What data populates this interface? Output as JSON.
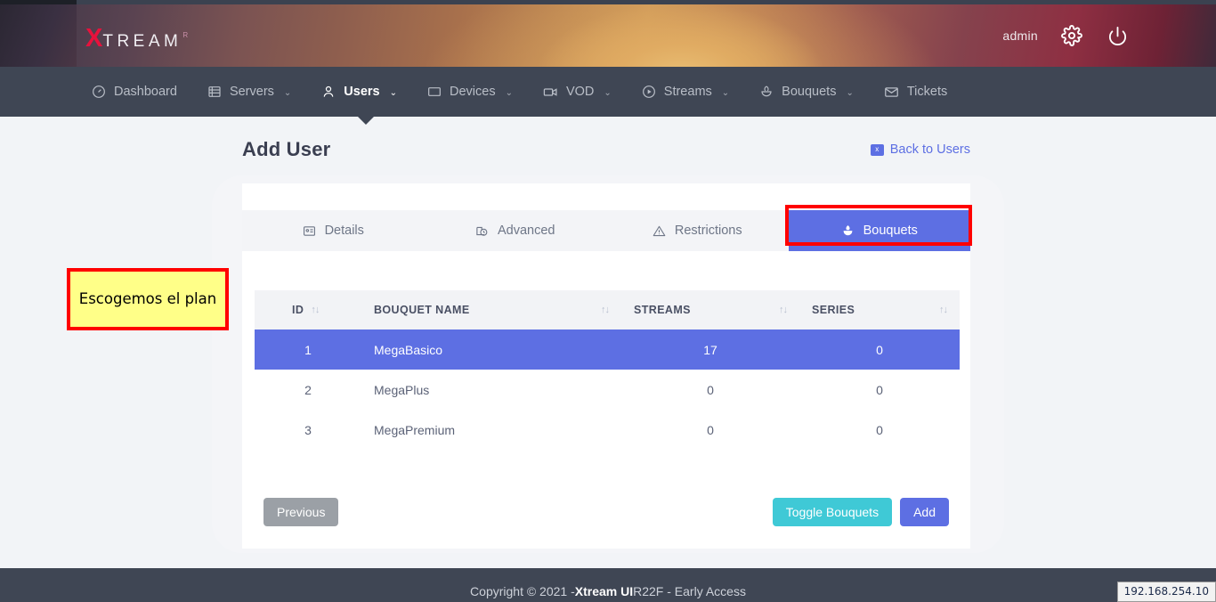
{
  "banner": {
    "logo_x": "X",
    "logo_rest": "TREAM",
    "logo_sup": "R",
    "admin_label": "admin",
    "gear_icon": "gear-icon",
    "power_icon": "power-icon"
  },
  "nav": {
    "items": [
      {
        "label": "Dashboard",
        "icon": "gauge-icon",
        "caret": "",
        "active": false
      },
      {
        "label": "Servers",
        "icon": "server-list-icon",
        "caret": "⌄",
        "active": false
      },
      {
        "label": "Users",
        "icon": "user-icon",
        "caret": "⌄",
        "active": true
      },
      {
        "label": "Devices",
        "icon": "device-icon",
        "caret": "⌄",
        "active": false
      },
      {
        "label": "VOD",
        "icon": "video-icon",
        "caret": "⌄",
        "active": false
      },
      {
        "label": "Streams",
        "icon": "play-circle-icon",
        "caret": "⌄",
        "active": false
      },
      {
        "label": "Bouquets",
        "icon": "bouquet-icon",
        "caret": "⌄",
        "active": false
      },
      {
        "label": "Tickets",
        "icon": "envelope-icon",
        "caret": "",
        "active": false
      }
    ]
  },
  "page": {
    "title": "Add User",
    "back_link": "Back to Users",
    "back_badge": "x"
  },
  "tabs": [
    {
      "label": "Details",
      "icon": "id-card-icon",
      "active": false
    },
    {
      "label": "Advanced",
      "icon": "clock-box-icon",
      "active": false
    },
    {
      "label": "Restrictions",
      "icon": "warning-triangle-icon",
      "active": false
    },
    {
      "label": "Bouquets",
      "icon": "bouquet-icon",
      "active": true
    }
  ],
  "table": {
    "columns": [
      {
        "label": "ID",
        "sort": "↑↓"
      },
      {
        "label": "BOUQUET NAME",
        "sort": "↑↓"
      },
      {
        "label": "STREAMS",
        "sort": "↑↓"
      },
      {
        "label": "SERIES",
        "sort": "↑↓"
      }
    ],
    "rows": [
      {
        "id": "1",
        "name": "MegaBasico",
        "streams": "17",
        "series": "0",
        "selected": true
      },
      {
        "id": "2",
        "name": "MegaPlus",
        "streams": "0",
        "series": "0",
        "selected": false
      },
      {
        "id": "3",
        "name": "MegaPremium",
        "streams": "0",
        "series": "0",
        "selected": false
      }
    ]
  },
  "buttons": {
    "previous": "Previous",
    "toggle_bouquets": "Toggle Bouquets",
    "add": "Add"
  },
  "annotation": {
    "text": "Escogemos el plan"
  },
  "footer": {
    "copyright_prefix": "Copyright © 2021 - ",
    "copyright_brand": "Xtream UI",
    "copyright_suffix": " R22F - Early Access"
  },
  "status_bar": {
    "ip": "192.168.254.10"
  },
  "colors": {
    "accent_blue": "#5d6fe3",
    "teal": "#3fc9d6",
    "grey_btn": "#9ba0a6",
    "navbar": "#3f4654",
    "highlight_red": "#ff0000",
    "annotation_yellow": "#ffff88",
    "logo_red": "#e8113c"
  }
}
